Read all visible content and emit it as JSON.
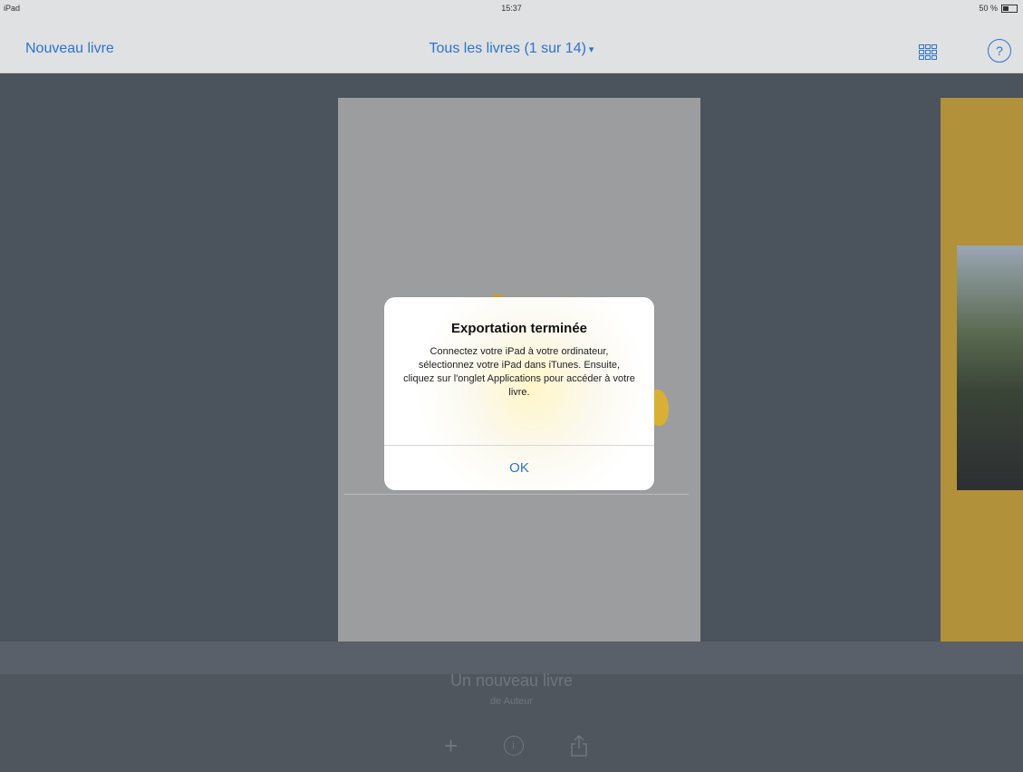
{
  "status_bar": {
    "device": "iPad",
    "time": "15:37",
    "battery": "50 %"
  },
  "nav": {
    "new_book_label": "Nouveau livre",
    "title": "Tous les livres (1 sur 14)",
    "title_caret": "▾",
    "help_label": "?"
  },
  "alert": {
    "title": "Exportation terminée",
    "message": "Connectez votre iPad à votre ordinateur, sélectionnez votre iPad dans iTunes. Ensuite, cliquez sur l'onglet Applications pour accéder à votre livre.",
    "ok_label": "OK"
  },
  "current_book": {
    "title": "Un nouveau livre",
    "author": "de Auteur"
  },
  "shelf_actions": {
    "add_label": "+",
    "info_label": "i"
  }
}
